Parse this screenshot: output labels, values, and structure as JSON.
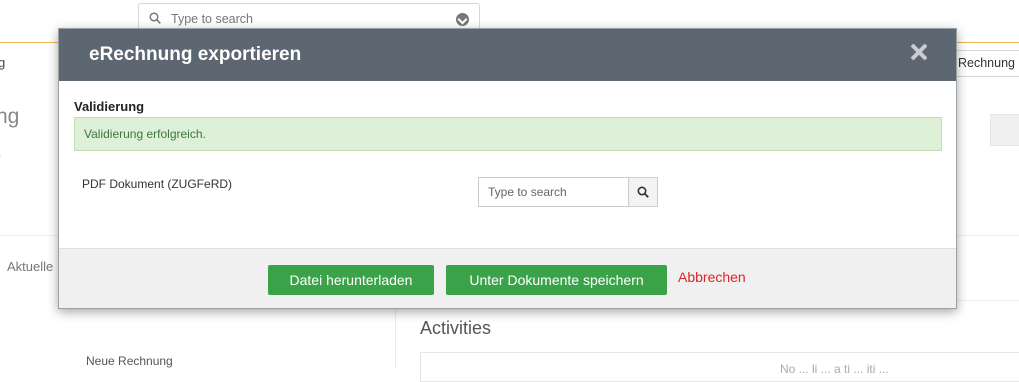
{
  "background": {
    "search_placeholder": "Type to search",
    "left_fragment_1": "g",
    "left_fragment_2": "ng",
    "left_fragment_3": "·",
    "tab_aktuelle": "Aktuelle",
    "rechnung_button": "Rechnung",
    "activities_title": "Activities",
    "no_activities": "No ... li ... a ti ... iti ...",
    "neue_rechnung": "Neue Rechnung"
  },
  "modal": {
    "title": "eRechnung exportieren",
    "close_icon": "close-icon",
    "validation": {
      "heading": "Validierung",
      "message": "Validierung erfolgreich."
    },
    "pdf_field": {
      "label": "PDF Dokument (ZUGFeRD)",
      "placeholder": "Type to search",
      "value": "",
      "button_icon": "search-icon"
    },
    "footer": {
      "download_label": "Datei herunterladen",
      "save_label": "Unter Dokumente speichern",
      "cancel_label": "Abbrechen"
    }
  },
  "colors": {
    "header_bg": "#5c6771",
    "success_bg": "#dff0d8",
    "success_text": "#3c763d",
    "primary_green": "#3aa34a",
    "cancel_red": "#d9262b",
    "accent_orange": "#e8b64a"
  }
}
